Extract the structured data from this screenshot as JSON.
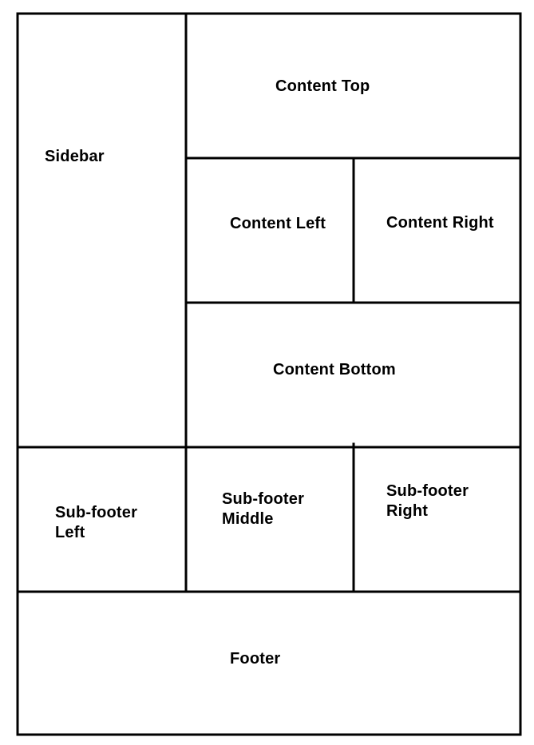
{
  "regions": {
    "sidebar": {
      "lines": [
        "Sidebar"
      ]
    },
    "content_top": {
      "lines": [
        "Content Top"
      ]
    },
    "content_left": {
      "lines": [
        "Content Left"
      ]
    },
    "content_right": {
      "lines": [
        "Content Right"
      ]
    },
    "content_bottom": {
      "lines": [
        "Content Bottom"
      ]
    },
    "subfooter_left": {
      "lines": [
        "Sub-footer",
        "Left"
      ]
    },
    "subfooter_middle": {
      "lines": [
        "Sub-footer",
        "Middle"
      ]
    },
    "subfooter_right": {
      "lines": [
        "Sub-footer",
        "Right"
      ]
    },
    "footer": {
      "lines": [
        "Footer"
      ]
    }
  },
  "colors": {
    "stroke": "#000000",
    "background": "#ffffff",
    "text": "#000000"
  }
}
